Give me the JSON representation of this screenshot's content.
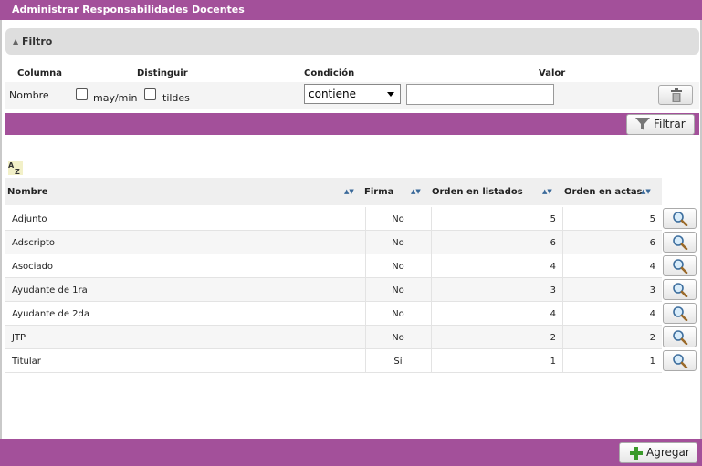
{
  "title": "Administrar Responsabilidades Docentes",
  "filter": {
    "section_label": "Filtro",
    "headers": {
      "columna": "Columna",
      "distinguir": "Distinguir",
      "condicion": "Condición",
      "valor": "Valor"
    },
    "row": {
      "column_name": "Nombre",
      "may_min_label": "may/min",
      "tildes_label": "tildes",
      "condition_value": "contiene",
      "value_input": ""
    },
    "filtrar_label": "Filtrar"
  },
  "table": {
    "columns": [
      "Nombre",
      "Firma",
      "Orden en listados",
      "Orden en actas"
    ],
    "rows": [
      {
        "nombre": "Adjunto",
        "firma": "No",
        "listados": "5",
        "actas": "5"
      },
      {
        "nombre": "Adscripto",
        "firma": "No",
        "listados": "6",
        "actas": "6"
      },
      {
        "nombre": "Asociado",
        "firma": "No",
        "listados": "4",
        "actas": "4"
      },
      {
        "nombre": "Ayudante de 1ra",
        "firma": "No",
        "listados": "3",
        "actas": "3"
      },
      {
        "nombre": "Ayudante de 2da",
        "firma": "No",
        "listados": "4",
        "actas": "4"
      },
      {
        "nombre": "JTP",
        "firma": "No",
        "listados": "2",
        "actas": "2"
      },
      {
        "nombre": "Titular",
        "firma": "Sí",
        "listados": "1",
        "actas": "1"
      }
    ]
  },
  "actions": {
    "agregar_label": "Agregar"
  },
  "icons": {
    "sort": "sort-az-icon",
    "trash": "trash-icon",
    "filter": "funnel-icon",
    "magnifier": "magnifier-icon",
    "add": "plus-icon"
  },
  "colors": {
    "accent": "#a3509a",
    "header_bg": "#dedede"
  }
}
